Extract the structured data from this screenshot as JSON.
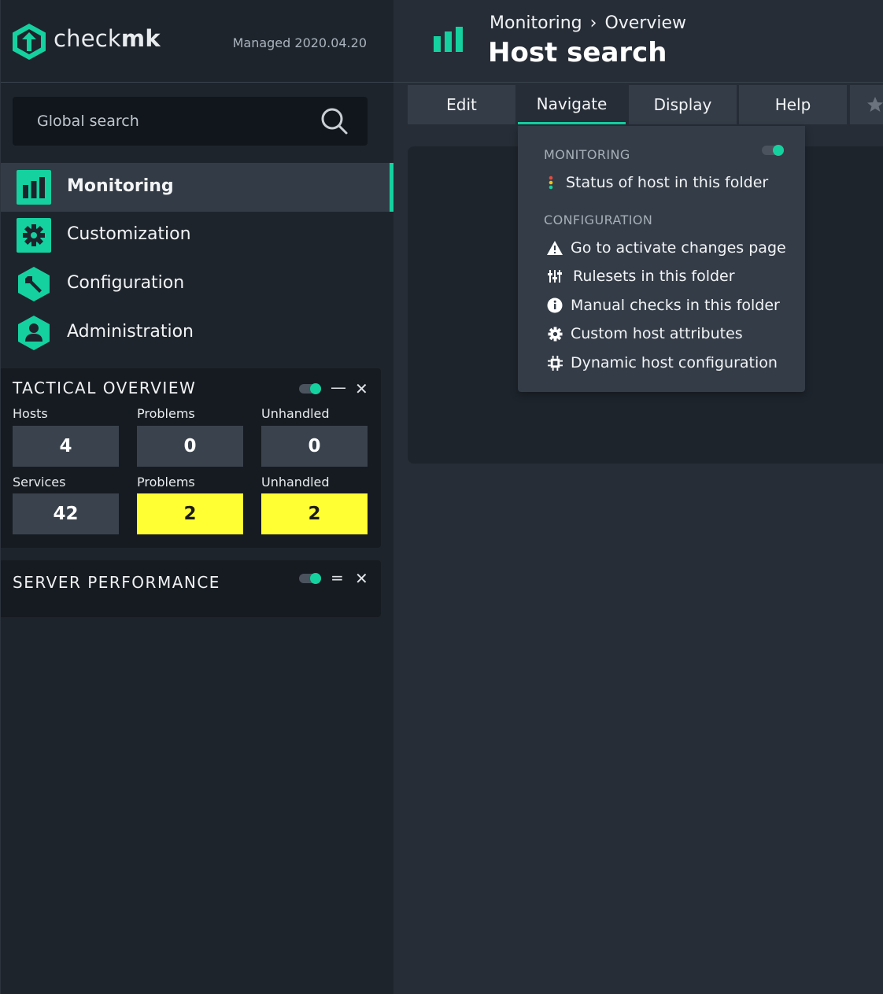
{
  "app": {
    "logo_word_regular": "check",
    "logo_word_bold": "mk",
    "edition": "Managed 2020.04.20",
    "brand_color": "#15d1a0",
    "warn_color": "#ffff33"
  },
  "search": {
    "placeholder": "Global search",
    "icon": "search-icon"
  },
  "sidebar": {
    "items": [
      {
        "label": "Monitoring",
        "icon": "monitoring-icon",
        "active": true
      },
      {
        "label": "Customization",
        "icon": "gear-icon",
        "active": false
      },
      {
        "label": "Configuration",
        "icon": "wrench-icon",
        "active": false
      },
      {
        "label": "Administration",
        "icon": "user-icon",
        "active": false
      }
    ]
  },
  "tactical_overview": {
    "title": "TACTICAL OVERVIEW",
    "headers_hosts": [
      "Hosts",
      "Problems",
      "Unhandled"
    ],
    "values_hosts": [
      "4",
      "0",
      "0"
    ],
    "headers_services": [
      "Services",
      "Problems",
      "Unhandled"
    ],
    "values_services": [
      "42",
      "2",
      "2"
    ]
  },
  "server_performance": {
    "title": "SERVER PERFORMANCE"
  },
  "header": {
    "breadcrumb": [
      "Monitoring",
      "Overview"
    ],
    "breadcrumb_sep": "›",
    "title": "Host search"
  },
  "menu": {
    "tabs": [
      "Edit",
      "Navigate",
      "Display",
      "Help"
    ],
    "active_tab": "Navigate"
  },
  "navigate_dropdown": {
    "sections": [
      {
        "title": "MONITORING",
        "items": [
          {
            "label": "Status of host in this folder",
            "icon": "status-dots-icon"
          }
        ]
      },
      {
        "title": "CONFIGURATION",
        "items": [
          {
            "label": "Go to activate changes page",
            "icon": "warning-icon"
          },
          {
            "label": "Rulesets in this folder",
            "icon": "sliders-icon"
          },
          {
            "label": "Manual checks in this folder",
            "icon": "info-icon"
          },
          {
            "label": "Custom host attributes",
            "icon": "gear-icon"
          },
          {
            "label": "Dynamic host configuration",
            "icon": "chip-icon"
          }
        ]
      }
    ]
  }
}
